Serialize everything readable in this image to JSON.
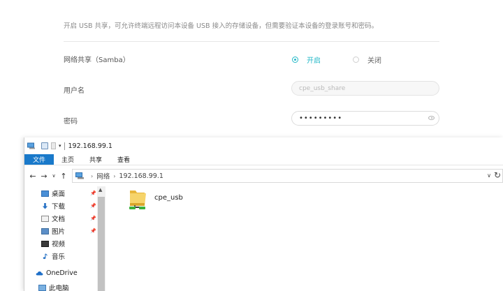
{
  "router": {
    "intro": "开启 USB 共享，可允许终端远程访问本设备 USB 接入的存储设备，但需要验证本设备的登录账号和密码。",
    "samba_label": "网络共享（Samba）",
    "radio_on": "开启",
    "radio_off": "关闭",
    "username_label": "用户名",
    "username_placeholder": "cpe_usb_share",
    "password_label": "密码",
    "password_value": "•••••••••",
    "accent_color": "#25b9c8"
  },
  "explorer": {
    "title": "192.168.99.1",
    "ribbon_tabs": [
      "文件",
      "主页",
      "共享",
      "查看"
    ],
    "address": {
      "crumbs": [
        "网络",
        "192.168.99.1"
      ]
    },
    "nav_items": [
      {
        "label": "桌面",
        "icon": "desktop-icon",
        "pinned": true
      },
      {
        "label": "下载",
        "icon": "download-icon",
        "pinned": true
      },
      {
        "label": "文档",
        "icon": "documents-icon",
        "pinned": true
      },
      {
        "label": "图片",
        "icon": "pictures-icon",
        "pinned": true
      },
      {
        "label": "视频",
        "icon": "videos-icon",
        "pinned": false
      },
      {
        "label": "音乐",
        "icon": "music-icon",
        "pinned": false
      },
      {
        "label": "OneDrive",
        "icon": "onedrive-icon",
        "pinned": false
      },
      {
        "label": "此电脑",
        "icon": "this-pc-icon",
        "pinned": false
      }
    ],
    "folder": {
      "name": "cpe_usb",
      "icon": "shared-folder-icon"
    },
    "accent_color": "#1979ca"
  }
}
